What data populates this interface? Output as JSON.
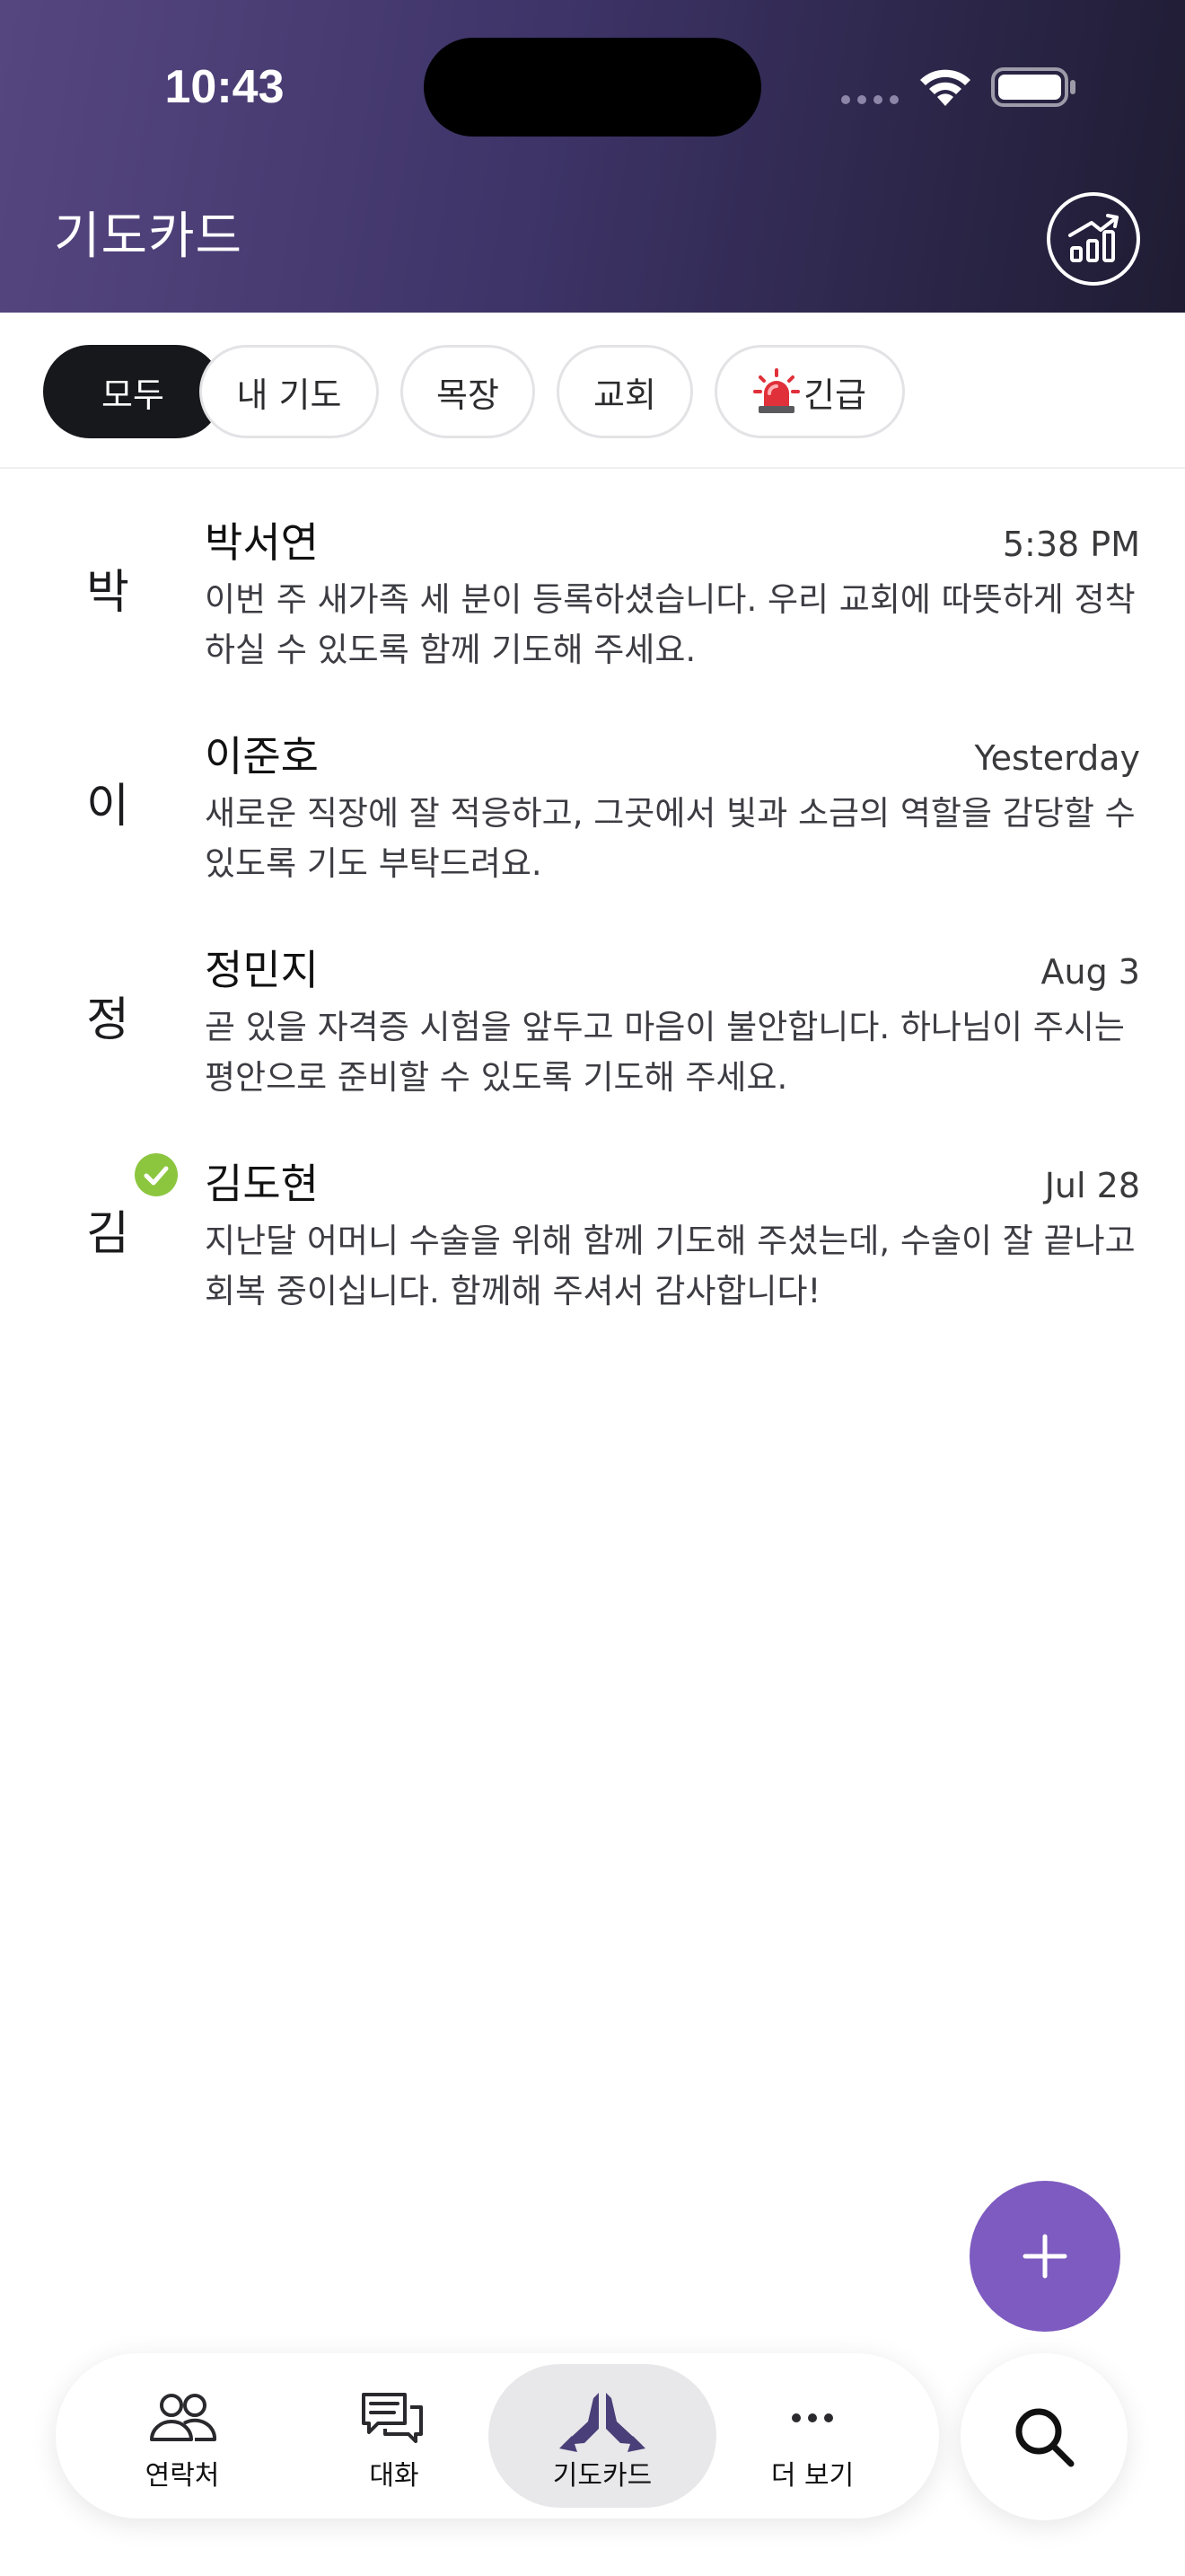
{
  "status_bar": {
    "time": "10:43"
  },
  "header": {
    "title": "기도카드",
    "stats_icon": "chart-bar-trend-icon"
  },
  "filters": [
    {
      "label": "모두",
      "active": true
    },
    {
      "label": "내 기도",
      "active": false
    },
    {
      "label": "목장",
      "active": false
    },
    {
      "label": "교회",
      "active": false
    },
    {
      "label": "긴급",
      "active": false,
      "icon": "siren-icon"
    }
  ],
  "prayers": [
    {
      "initial": "박",
      "name": "박서연",
      "time": "5:38 PM",
      "line1": "이번 주 새가족 세 분이 등록하셨습니다. 우리 교회에 따뜻하게 정착",
      "line2": "하실 수 있도록 함께 기도해 주세요.",
      "answered": false
    },
    {
      "initial": "이",
      "name": "이준호",
      "time": "Yesterday",
      "line1": "새로운 직장에 잘 적응하고, 그곳에서 빛과 소금의 역할을 감당할 수",
      "line2": "있도록 기도 부탁드려요.",
      "answered": false
    },
    {
      "initial": "정",
      "name": "정민지",
      "time": "Aug 3",
      "line1": "곧 있을 자격증 시험을 앞두고 마음이 불안합니다. 하나님이 주시는",
      "line2": "평안으로 준비할 수 있도록 기도해 주세요.",
      "answered": false
    },
    {
      "initial": "김",
      "name": "김도현",
      "time": "Jul 28",
      "line1": "지난달 어머니 수술을 위해 함께 기도해 주셨는데, 수술이 잘 끝나고",
      "line2": "회복 중이십니다. 함께해 주셔서 감사합니다!",
      "answered": true
    }
  ],
  "tabbar": {
    "tabs": [
      {
        "label": "연락처",
        "icon": "people-icon",
        "active": false
      },
      {
        "label": "대화",
        "icon": "chat-bubbles-icon",
        "active": false
      },
      {
        "label": "기도카드",
        "icon": "praying-hands-icon",
        "active": true
      },
      {
        "label": "더 보기",
        "icon": "more-dots-icon",
        "active": false
      }
    ],
    "search_icon": "search-icon"
  },
  "colors": {
    "header_start": "#564680",
    "header_end": "#1f1c33",
    "accent": "#7d5bc0",
    "answered_green": "#8cc63f",
    "chip_active": "#17181c"
  }
}
